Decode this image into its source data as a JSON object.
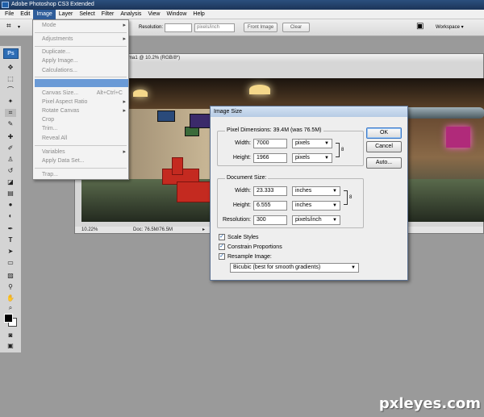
{
  "app": {
    "title": "Adobe Photoshop CS3 Extended"
  },
  "menubar": [
    "File",
    "Edit",
    "Image",
    "Layer",
    "Select",
    "Filter",
    "Analysis",
    "View",
    "Window",
    "Help"
  ],
  "options": {
    "resolution_label": "Resolution:",
    "unit_value": "pixels/inch",
    "front_image": "Front Image",
    "clear": "Clear",
    "workspace": "Workspace ▾"
  },
  "image_menu": {
    "items": [
      {
        "label": "Mode",
        "submenu": true
      },
      {
        "label": "Adjustments",
        "submenu": true
      },
      {
        "label": "Duplicate..."
      },
      {
        "label": "Apply Image..."
      },
      {
        "label": "Calculations..."
      },
      {
        "label": "Canvas Size...",
        "shortcut": "Alt+Ctrl+C"
      },
      {
        "label": "Pixel Aspect Ratio",
        "submenu": true
      },
      {
        "label": "Rotate Canvas",
        "submenu": true
      },
      {
        "label": "Crop"
      },
      {
        "label": "Trim..."
      },
      {
        "label": "Reveal All"
      },
      {
        "label": "Variables",
        "submenu": true
      },
      {
        "label": "Apply Data Set..."
      },
      {
        "label": "Trap..."
      }
    ]
  },
  "document": {
    "title": "ma1 @ 10.2% (RGB/8*)",
    "zoom": "10.22%",
    "doc_info": "Doc: 76.5M/76.5M"
  },
  "dialog": {
    "title": "Image Size",
    "pixel_dimensions": "Pixel Dimensions:  39.4M (was 76.5M)",
    "px_width_label": "Width:",
    "px_width": "7000",
    "px_width_unit": "pixels",
    "px_height_label": "Height:",
    "px_height": "1966",
    "px_height_unit": "pixels",
    "document_size": "Document Size:",
    "doc_width_label": "Width:",
    "doc_width": "23.333",
    "doc_width_unit": "inches",
    "doc_height_label": "Height:",
    "doc_height": "6.555",
    "doc_height_unit": "inches",
    "resolution_label": "Resolution:",
    "resolution": "300",
    "resolution_unit": "pixels/inch",
    "scale_styles": "Scale Styles",
    "constrain": "Constrain Proportions",
    "resample": "Resample Image:",
    "resample_method": "Bicubic (best for smooth gradients)",
    "ok": "OK",
    "cancel": "Cancel",
    "auto": "Auto..."
  },
  "watermark": "pxleyes.com",
  "colors": {
    "accent": "#2f5d9a",
    "highlight": "#6a9ad6"
  }
}
